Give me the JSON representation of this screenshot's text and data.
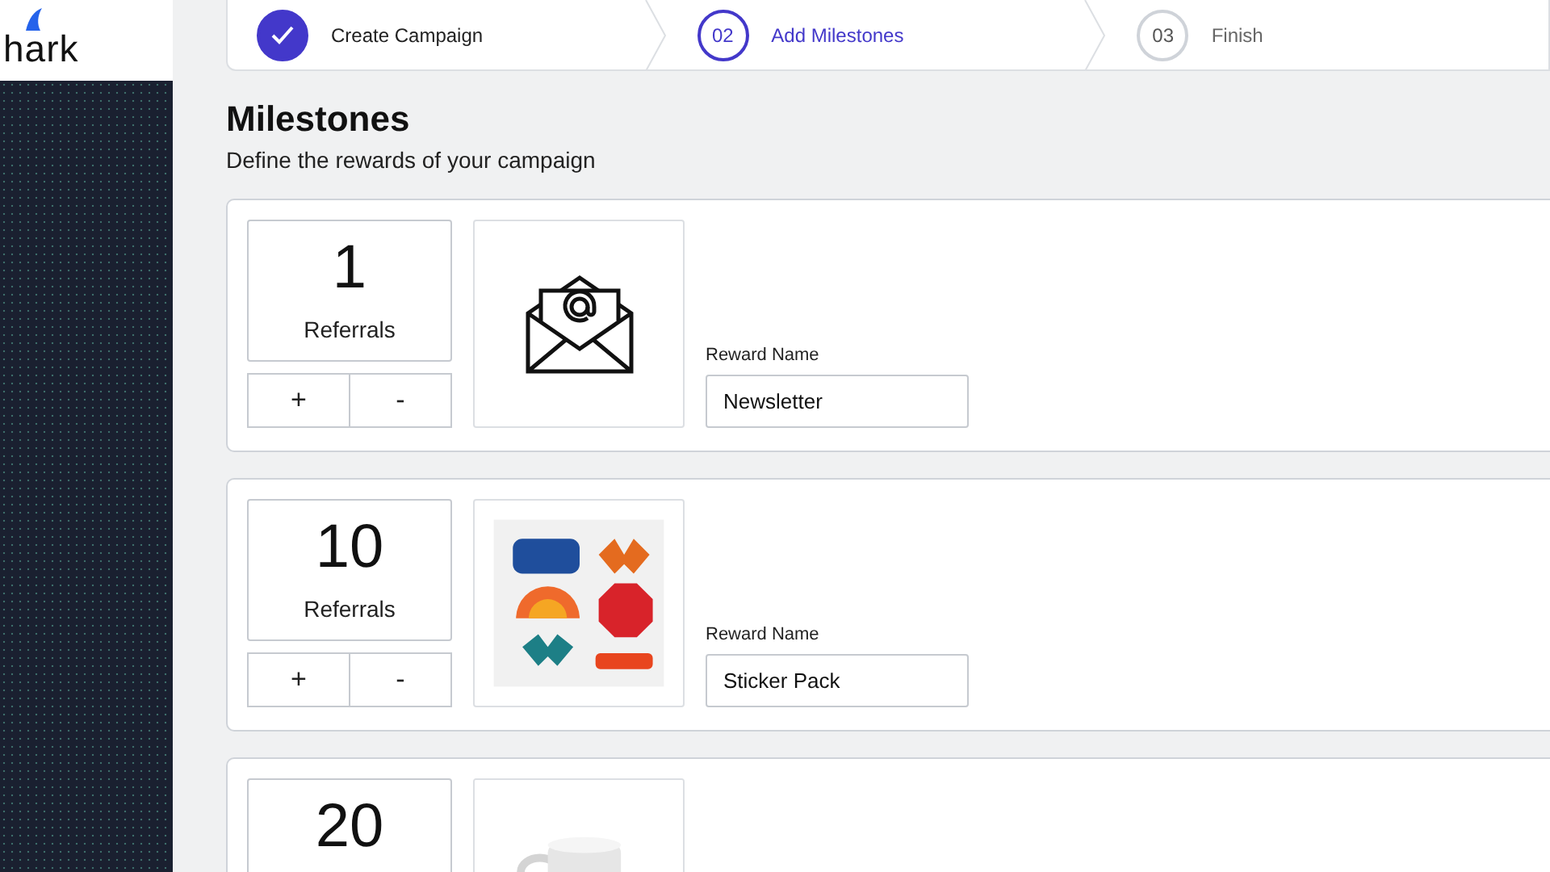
{
  "logo": {
    "text": "hark"
  },
  "steps": [
    {
      "label": "Create Campaign",
      "complete": true,
      "selected": false
    },
    {
      "number": "02",
      "label": "Add Milestones",
      "complete": false,
      "selected": true
    },
    {
      "number": "03",
      "label": "Finish",
      "complete": false,
      "selected": false
    }
  ],
  "page": {
    "title": "Milestones",
    "subtitle": "Define the rewards of your campaign"
  },
  "milestones": [
    {
      "count": "1",
      "unit": "Referrals",
      "plus": "+",
      "minus": "-",
      "image": {
        "kind": "envelope"
      },
      "reward_label": "Reward Name",
      "reward_value": "Newsletter"
    },
    {
      "count": "10",
      "unit": "Referrals",
      "plus": "+",
      "minus": "-",
      "reward_label": "Reward Name",
      "reward_value": "Sticker Pack"
    },
    {
      "count": "20"
    }
  ]
}
